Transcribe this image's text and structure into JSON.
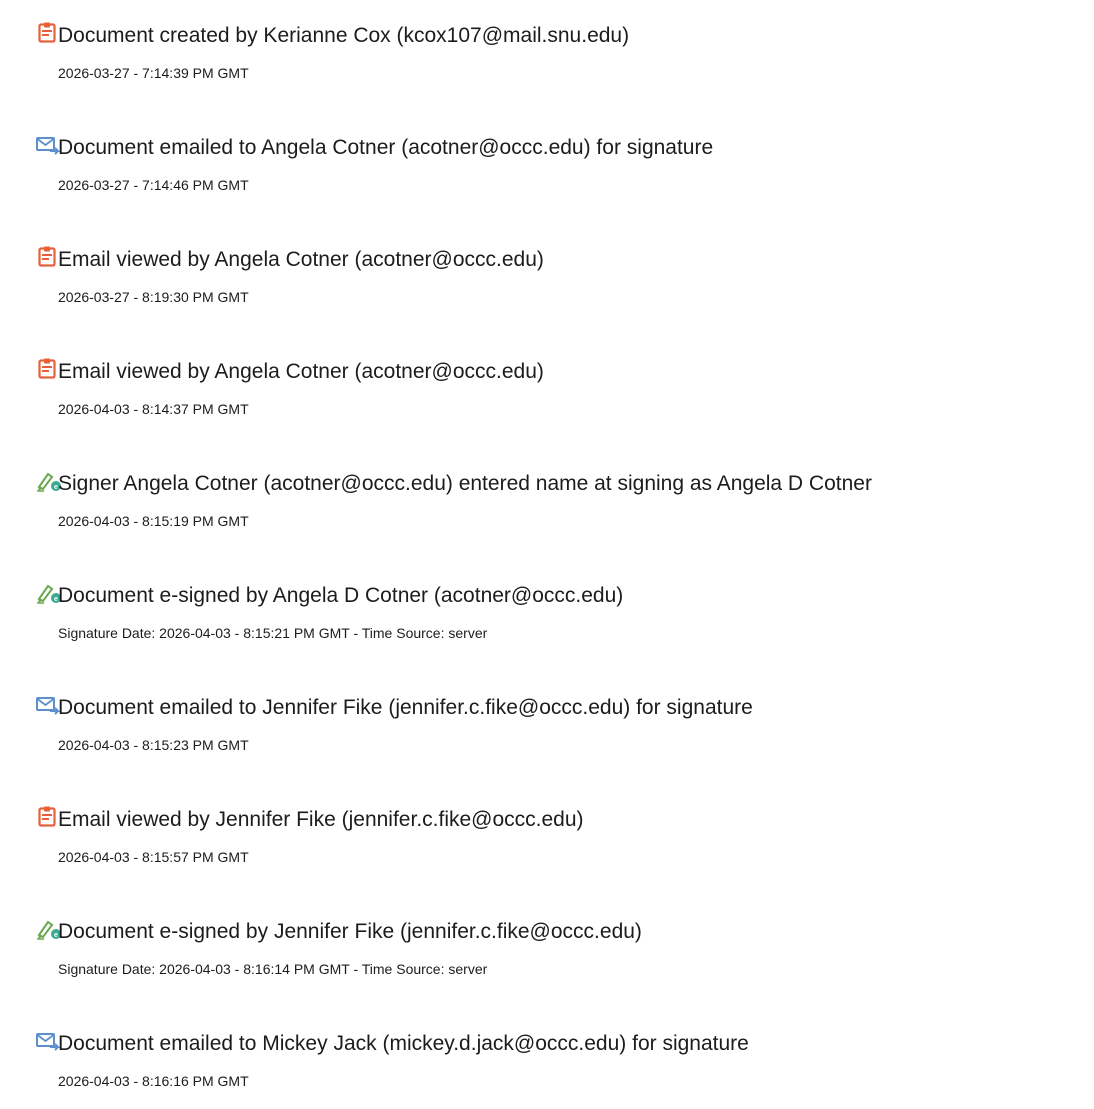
{
  "events": [
    {
      "icon": "document-icon",
      "title": "Document created by Kerianne Cox (kcox107@mail.snu.edu)",
      "stamp": "2026-03-27 - 7:14:39 PM GMT"
    },
    {
      "icon": "email-sent-icon",
      "title": "Document emailed to Angela Cotner (acotner@occc.edu) for signature",
      "stamp": "2026-03-27 - 7:14:46 PM GMT"
    },
    {
      "icon": "document-icon",
      "title": "Email viewed by Angela Cotner (acotner@occc.edu)",
      "stamp": "2026-03-27 - 8:19:30 PM GMT"
    },
    {
      "icon": "document-icon",
      "title": "Email viewed by Angela Cotner (acotner@occc.edu)",
      "stamp": "2026-04-03 - 8:14:37 PM GMT"
    },
    {
      "icon": "esign-pen-icon",
      "title": "Signer Angela Cotner (acotner@occc.edu) entered name at signing as Angela D Cotner",
      "stamp": "2026-04-03 - 8:15:19 PM GMT"
    },
    {
      "icon": "esign-pen-icon",
      "title": "Document e-signed by Angela D Cotner (acotner@occc.edu)",
      "stamp": "Signature Date: 2026-04-03 - 8:15:21 PM GMT - Time Source: server"
    },
    {
      "icon": "email-sent-icon",
      "title": "Document emailed to Jennifer Fike (jennifer.c.fike@occc.edu) for signature",
      "stamp": "2026-04-03 - 8:15:23 PM GMT"
    },
    {
      "icon": "document-icon",
      "title": "Email viewed by Jennifer Fike (jennifer.c.fike@occc.edu)",
      "stamp": "2026-04-03 - 8:15:57 PM GMT"
    },
    {
      "icon": "esign-pen-icon",
      "title": "Document e-signed by Jennifer Fike (jennifer.c.fike@occc.edu)",
      "stamp": "Signature Date: 2026-04-03 - 8:16:14 PM GMT - Time Source: server"
    },
    {
      "icon": "email-sent-icon",
      "title": "Document emailed to Mickey Jack (mickey.d.jack@occc.edu) for signature",
      "stamp": "2026-04-03 - 8:16:16 PM GMT"
    }
  ],
  "colors": {
    "document_icon": "#e8603a",
    "email_icon": "#5b8fd0",
    "esign_pen": "#6aa84f",
    "esign_badge": "#3aa890"
  }
}
